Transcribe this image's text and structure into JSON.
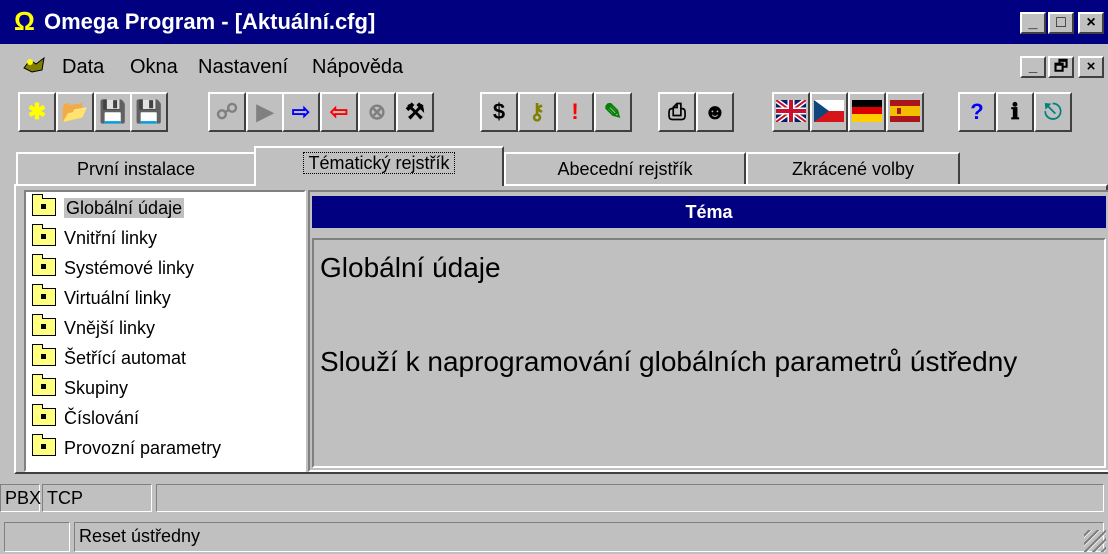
{
  "window": {
    "title": "Omega Program - [Aktuální.cfg]",
    "icon": "omega-icon",
    "title_bg": "#000080",
    "caption_buttons": [
      "_",
      "□",
      "×"
    ]
  },
  "menubar": {
    "items": [
      "Data",
      "Okna",
      "Nastavení",
      "Nápověda"
    ],
    "mdi_buttons": [
      "_",
      "🗗",
      "×"
    ]
  },
  "toolbar": {
    "buttons": [
      {
        "name": "new-icon",
        "glyph": "✱",
        "color": "#ffff00"
      },
      {
        "name": "open-icon",
        "glyph": "📂",
        "color": "#808000"
      },
      {
        "name": "save-icon",
        "glyph": "💾",
        "color": "#000080"
      },
      {
        "name": "save-as-icon",
        "glyph": "💾",
        "color": "#000080"
      },
      {
        "name": "connect-icon",
        "glyph": "☍",
        "color": "#808080"
      },
      {
        "name": "play-icon",
        "glyph": "▶",
        "color": "#808080"
      },
      {
        "name": "transfer-icon",
        "glyph": "⇨",
        "color": "#0000ff"
      },
      {
        "name": "receive-icon",
        "glyph": "⇦",
        "color": "#ff0000"
      },
      {
        "name": "stop-icon",
        "glyph": "⊗",
        "color": "#808080"
      },
      {
        "name": "tools-icon",
        "glyph": "⚒",
        "color": "#000000"
      },
      {
        "name": "dollar-icon",
        "glyph": "$",
        "color": "#000000"
      },
      {
        "name": "key-icon",
        "glyph": "⚷",
        "color": "#808000"
      },
      {
        "name": "alarm-icon",
        "glyph": "!",
        "color": "#ff0000"
      },
      {
        "name": "notes-icon",
        "glyph": "✎",
        "color": "#008000"
      },
      {
        "name": "print-icon",
        "glyph": "⎙",
        "color": "#000000"
      },
      {
        "name": "user-icon",
        "glyph": "☻",
        "color": "#000000"
      },
      {
        "name": "flag-uk-icon",
        "glyph": "",
        "color": "#012169"
      },
      {
        "name": "flag-cz-icon",
        "glyph": "",
        "color": "#d7141a"
      },
      {
        "name": "flag-de-icon",
        "glyph": "",
        "color": "#000000"
      },
      {
        "name": "flag-es-icon",
        "glyph": "",
        "color": "#aa151b"
      },
      {
        "name": "help-icon",
        "glyph": "?",
        "color": "#0000ff"
      },
      {
        "name": "info-icon",
        "glyph": "ℹ",
        "color": "#000000"
      },
      {
        "name": "exit-icon",
        "glyph": "⎋",
        "color": "#008080"
      }
    ]
  },
  "tabs": [
    {
      "label": "První instalace",
      "active": false
    },
    {
      "label": "Tématický rejstřík",
      "active": true
    },
    {
      "label": "Abecední rejstřík",
      "active": false
    },
    {
      "label": "Zkrácené volby",
      "active": false
    }
  ],
  "tree": {
    "items": [
      {
        "label": "Globální údaje",
        "selected": true
      },
      {
        "label": "Vnitřní linky"
      },
      {
        "label": "Systémové linky"
      },
      {
        "label": "Virtuální linky"
      },
      {
        "label": "Vnější linky"
      },
      {
        "label": "Šetřící automat"
      },
      {
        "label": "Skupiny"
      },
      {
        "label": "Číslování"
      },
      {
        "label": "Provozní parametry"
      }
    ]
  },
  "topic": {
    "header": "Téma",
    "title": "Globální údaje",
    "description": "Slouží k naprogramování globálních parametrů ústředny"
  },
  "statusbar1": {
    "cells": [
      "PBX",
      "TCP",
      ""
    ]
  },
  "statusbar2": {
    "cells": [
      "",
      "Reset ústředny"
    ]
  }
}
